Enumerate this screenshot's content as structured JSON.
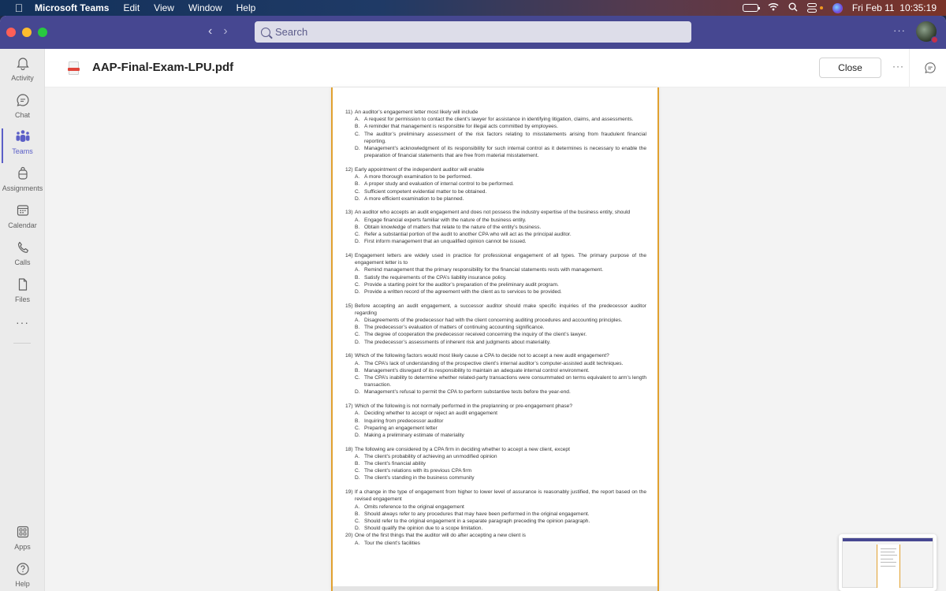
{
  "menubar": {
    "apple_icon": "apple-logo",
    "app_name": "Microsoft Teams",
    "menus": [
      "Edit",
      "View",
      "Window",
      "Help"
    ],
    "status_icons": [
      "battery-icon",
      "wifi-icon",
      "spotlight-search-icon",
      "control-center-icon",
      "siri-icon"
    ],
    "datetime": "Fri Feb 11  10:35:19"
  },
  "titlebar": {
    "back_icon": "chevron-left-icon",
    "forward_icon": "chevron-right-icon",
    "search_placeholder": "Search",
    "more_label": "···",
    "presence_color": "#c4314b"
  },
  "rail": {
    "items": [
      {
        "label": "Activity",
        "icon": "bell-icon",
        "active": false
      },
      {
        "label": "Chat",
        "icon": "chat-icon",
        "active": false
      },
      {
        "label": "Teams",
        "icon": "teams-icon",
        "active": true
      },
      {
        "label": "Assignments",
        "icon": "backpack-icon",
        "active": false
      },
      {
        "label": "Calendar",
        "icon": "calendar-icon",
        "active": false
      },
      {
        "label": "Calls",
        "icon": "phone-icon",
        "active": false
      },
      {
        "label": "Files",
        "icon": "file-icon",
        "active": false
      }
    ],
    "more_label": "···",
    "bottom_items": [
      {
        "label": "Apps",
        "icon": "apps-icon"
      },
      {
        "label": "Help",
        "icon": "help-icon"
      }
    ],
    "accent_color": "#5b5fc7"
  },
  "file_header": {
    "file_name": "AAP-Final-Exam-LPU.pdf",
    "close_label": "Close",
    "more_label": "···"
  },
  "document": {
    "questions": [
      {
        "num": "11)",
        "text": "An auditor’s engagement letter most likely will include",
        "options": [
          {
            "letter": "A.",
            "text": "A request for permission to contact the client’s lawyer for assistance in identifying litigation, claims, and assessments."
          },
          {
            "letter": "B.",
            "text": "A reminder that management is responsible for illegal acts committed by employees."
          },
          {
            "letter": "C.",
            "text": "The auditor’s preliminary assessment of the risk factors relating to misstatements arising from fraudulent financial reporting."
          },
          {
            "letter": "D.",
            "text": "Management’s acknowledgment of its responsibility for such internal control as it determines is necessary to enable the preparation of financial statements that are free from material misstatement."
          }
        ]
      },
      {
        "num": "12)",
        "text": "Early appointment of the independent auditor will enable",
        "options": [
          {
            "letter": "A.",
            "text": "A more thorough examination to be performed."
          },
          {
            "letter": "B.",
            "text": "A proper study and evaluation of internal control to be performed."
          },
          {
            "letter": "C.",
            "text": "Sufficient competent evidential matter to be obtained."
          },
          {
            "letter": "D.",
            "text": "A more efficient examination to be planned."
          }
        ]
      },
      {
        "num": "13)",
        "text": "An auditor who accepts an audit engagement and does not possess the industry expertise of the business entity, should",
        "options": [
          {
            "letter": "A.",
            "text": "Engage financial experts familiar with the nature of the business entity."
          },
          {
            "letter": "B.",
            "text": "Obtain knowledge of matters that relate to the nature of the entity’s business."
          },
          {
            "letter": "C.",
            "text": "Refer a substantial portion of the audit to another CPA who will act as the principal auditor."
          },
          {
            "letter": "D.",
            "text": "First inform management that an unqualified opinion cannot be issued."
          }
        ]
      },
      {
        "num": "14)",
        "text": "Engagement letters are widely used in practice for professional engagement of all types. The primary purpose of the engagement letter is to",
        "options": [
          {
            "letter": "A.",
            "text": "Remind management that the primary responsibility for the financial statements rests with management."
          },
          {
            "letter": "B.",
            "text": "Satisfy the requirements of the CPA’s liability insurance policy."
          },
          {
            "letter": "C.",
            "text": "Provide a starting point for the auditor’s preparation of the preliminary audit program."
          },
          {
            "letter": "D.",
            "text": "Provide a written record of the agreement with the client as to services to be provided."
          }
        ]
      },
      {
        "num": "15)",
        "text": "Before accepting an audit engagement, a successor auditor should make specific inquiries of the predecessor auditor regarding",
        "options": [
          {
            "letter": "A.",
            "text": "Disagreements of the predecessor had with the client concerning auditing procedures and accounting principles."
          },
          {
            "letter": "B.",
            "text": "The predecessor’s evaluation of matters of continuing accounting significance."
          },
          {
            "letter": "C.",
            "text": "The degree of cooperation the predecessor received concerning the inquiry of the client’s lawyer."
          },
          {
            "letter": "D.",
            "text": "The predecessor’s assessments of inherent risk and judgments about materiality."
          }
        ]
      },
      {
        "num": "16)",
        "text": "Which of the following factors would most likely cause a CPA to decide not to accept a new audit engagement?",
        "options": [
          {
            "letter": "A.",
            "text": "The CPA’s lack of understanding of the prospective client’s internal auditor’s computer-assisted audit techniques."
          },
          {
            "letter": "B.",
            "text": "Management’s disregard of its responsibility to maintain an adequate internal control environment."
          },
          {
            "letter": "C.",
            "text": "The CPA’s inability to determine whether related-party transactions were consummated on terms equivalent to arm’s length transaction."
          },
          {
            "letter": "D.",
            "text": "Management’s refusal to permit the CPA to perform substantive tests before the year-end."
          }
        ]
      },
      {
        "num": "17)",
        "text": "Which of the following is not normally performed in the preplanning or pre-engagement phase?",
        "options": [
          {
            "letter": "A.",
            "text": "Deciding whether to accept or reject an audit engagement"
          },
          {
            "letter": "B.",
            "text": "Inquiring from predecessor auditor"
          },
          {
            "letter": "C.",
            "text": "Preparing an engagement letter"
          },
          {
            "letter": "D.",
            "text": "Making a preliminary estimate of materiality"
          }
        ]
      },
      {
        "num": "18)",
        "text": "The following are considered by a CPA firm in deciding whether to accept a new client, except",
        "options": [
          {
            "letter": "A.",
            "text": "The client’s probability of achieving an unmodified opinion"
          },
          {
            "letter": "B.",
            "text": "The client’s financial ability"
          },
          {
            "letter": "C.",
            "text": "The client’s relations with its previous CPA firm"
          },
          {
            "letter": "D.",
            "text": "The client’s standing in the business community"
          }
        ]
      },
      {
        "num": "19)",
        "text": "If a change in the type of engagement from higher to lower level of assurance is reasonably justified, the report based on the revised engagement",
        "options": [
          {
            "letter": "A.",
            "text": "Omits reference to the original engagement"
          },
          {
            "letter": "B.",
            "text": "Should always refer to any procedures that may have been performed in the original engagement."
          },
          {
            "letter": "C.",
            "text": "Should refer to the original engagement in a separate paragraph preceding the opinion paragraph."
          },
          {
            "letter": "D.",
            "text": "Should qualify the opinion due to a scope limitation."
          }
        ]
      },
      {
        "num": "20)",
        "text": "One of the first things that the auditor will do after accepting a new client is",
        "options": [
          {
            "letter": "A.",
            "text": "Tour the client’s facilities"
          }
        ]
      }
    ],
    "page_border_color": "#e1a12f"
  },
  "thumbnail": {
    "label": "window-preview-thumbnail"
  }
}
